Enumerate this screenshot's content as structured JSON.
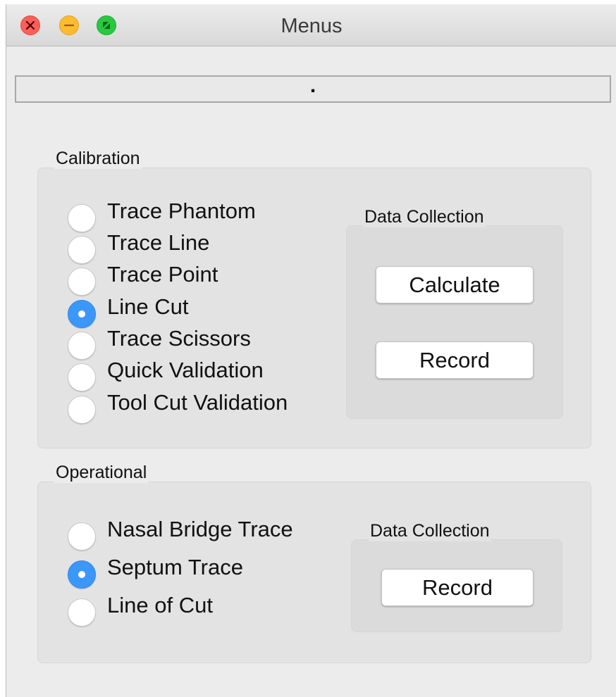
{
  "window": {
    "title": "Menus"
  },
  "status_field": {
    "value": "."
  },
  "calibration": {
    "label": "Calibration",
    "options": [
      {
        "label": "Trace Phantom",
        "checked": false
      },
      {
        "label": "Trace Line",
        "checked": false
      },
      {
        "label": "Trace Point",
        "checked": false
      },
      {
        "label": "Line Cut",
        "checked": true
      },
      {
        "label": "Trace Scissors",
        "checked": false
      },
      {
        "label": "Quick Validation",
        "checked": false
      },
      {
        "label": "Tool Cut Validation",
        "checked": false
      }
    ],
    "data_collection": {
      "label": "Data Collection",
      "calculate_label": "Calculate",
      "record_label": "Record"
    }
  },
  "operational": {
    "label": "Operational",
    "options": [
      {
        "label": "Nasal Bridge Trace",
        "checked": false
      },
      {
        "label": "Septum Trace",
        "checked": true
      },
      {
        "label": "Line of Cut",
        "checked": false
      }
    ],
    "data_collection": {
      "label": "Data Collection",
      "record_label": "Record"
    }
  },
  "icons": {
    "close": "close-icon",
    "minimize": "minimize-icon",
    "maximize": "fullscreen-icon"
  },
  "colors": {
    "accent": "#3c97fb",
    "close": "#fc5f57",
    "minimize": "#fdbc2e",
    "maximize": "#28c940"
  }
}
